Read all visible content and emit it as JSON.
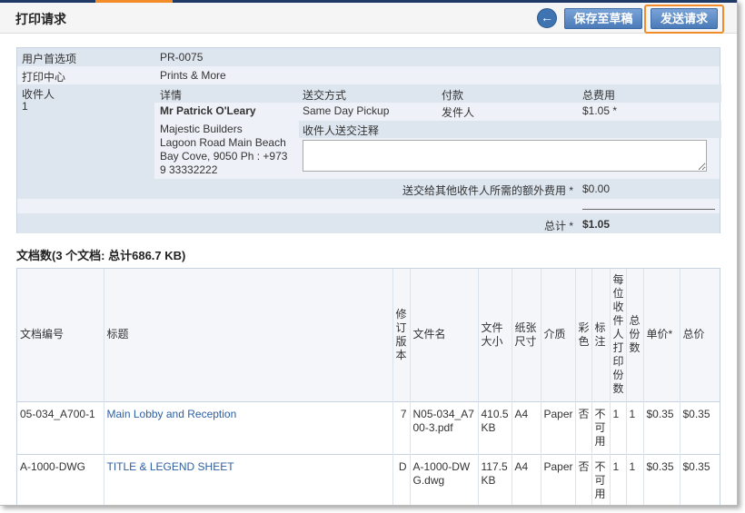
{
  "header": {
    "title": "打印请求",
    "save_label": "保存至草稿",
    "send_label": "发送请求"
  },
  "info": {
    "preference_label": "用户首选项",
    "preference_value": "PR-0075",
    "print_center_label": "打印中心",
    "print_center_value": "Prints & More",
    "recipient_label": "收件人",
    "recipient_index": "1",
    "col_details": "详情",
    "col_delivery": "送交方式",
    "col_payment": "付款",
    "col_total": "总费用",
    "recipient_name": "Mr Patrick O'Leary",
    "delivery_method": "Same Day Pickup",
    "payment": "发件人",
    "total_fee": "$1.05 *",
    "address_line1": "Majestic Builders",
    "address_line2": "Lagoon Road Main Beach",
    "address_line3": "Bay Cove, 9050 Ph : +973",
    "address_line4": "9 33332222",
    "notes_label": "收件人送交注释",
    "notes_value": "",
    "extra_fee_label": "送交给其他收件人所需的额外费用 *",
    "extra_fee_value": "$0.00",
    "grand_total_label": "总计 *",
    "grand_total_value": "$1.05"
  },
  "documents": {
    "heading": "文档数(3 个文档: 总计686.7 KB)",
    "columns": [
      "文档编号",
      "标题",
      "修订版本",
      "文件名",
      "文件大小",
      "纸张尺寸",
      "介质",
      "彩色",
      "标注",
      "每位收件人打印份数",
      "总份数",
      "单价*",
      "总价"
    ],
    "rows": [
      {
        "number": "05-034_A700-1",
        "title": "Main Lobby and Reception",
        "revision": "7",
        "filename": "N05-034_A700-3.pdf",
        "size": "410.5 KB",
        "paper": "A4",
        "media": "Paper",
        "color": "否",
        "markup": "不可用",
        "copies_each": "1",
        "total_copies": "1",
        "unit_price": "$0.35",
        "total_price": "$0.35"
      },
      {
        "number": "A-1000-DWG",
        "title": "TITLE & LEGEND SHEET",
        "revision": "D",
        "filename": "A-1000-DWG.dwg",
        "size": "117.5 KB",
        "paper": "A4",
        "media": "Paper",
        "color": "否",
        "markup": "不可用",
        "copies_each": "1",
        "total_copies": "1",
        "unit_price": "$0.35",
        "total_price": "$0.35"
      }
    ]
  }
}
